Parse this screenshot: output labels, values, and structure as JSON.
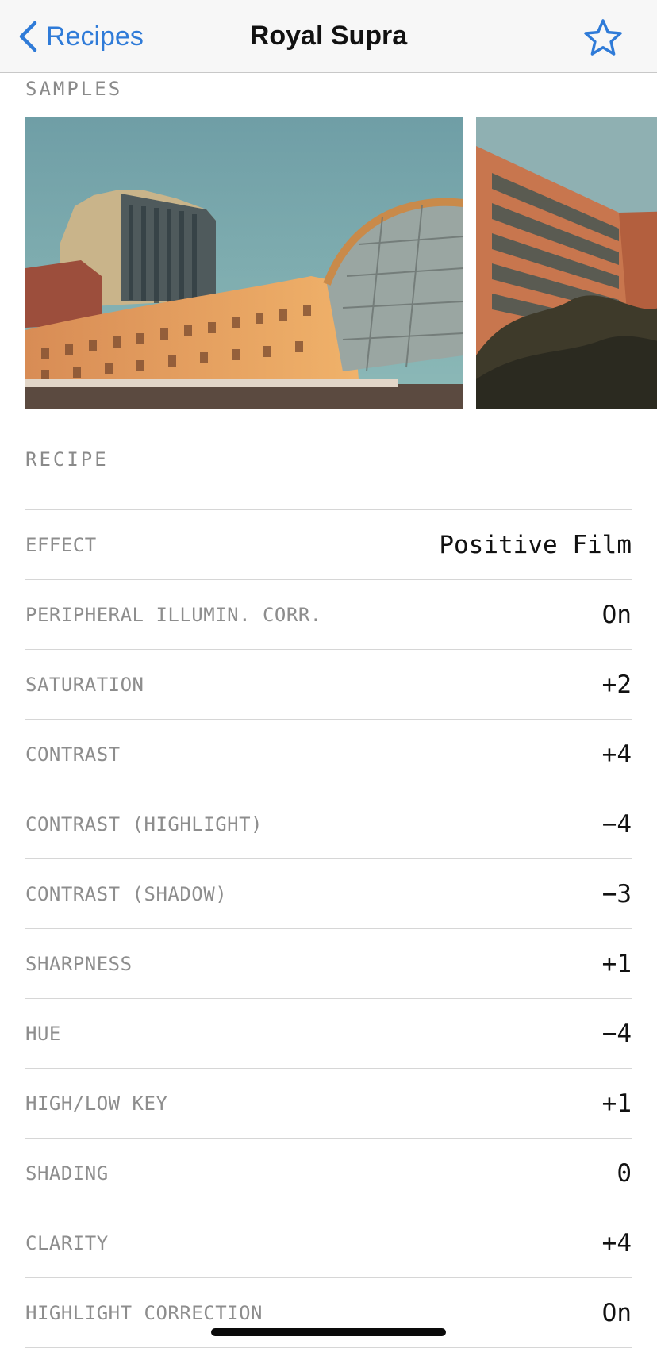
{
  "nav": {
    "back_label": "Recipes",
    "title": "Royal Supra",
    "accent_color": "#2f7bd8"
  },
  "icons": {
    "back": "chevron-left-icon",
    "favorite": "star-outline-icon"
  },
  "samples": {
    "label": "SAMPLES"
  },
  "recipe": {
    "label": "RECIPE",
    "rows": [
      {
        "key": "EFFECT",
        "value": "Positive Film"
      },
      {
        "key": "PERIPHERAL ILLUMIN. CORR.",
        "value": "On"
      },
      {
        "key": "SATURATION",
        "value": "+2"
      },
      {
        "key": "CONTRAST",
        "value": "+4"
      },
      {
        "key": "CONTRAST (HIGHLIGHT)",
        "value": "−4"
      },
      {
        "key": "CONTRAST (SHADOW)",
        "value": "−3"
      },
      {
        "key": "SHARPNESS",
        "value": "+1"
      },
      {
        "key": "HUE",
        "value": "−4"
      },
      {
        "key": "HIGH/LOW KEY",
        "value": "+1"
      },
      {
        "key": "SHADING",
        "value": "0"
      },
      {
        "key": "CLARITY",
        "value": "+4"
      },
      {
        "key": "HIGHLIGHT CORRECTION",
        "value": "On"
      }
    ]
  }
}
